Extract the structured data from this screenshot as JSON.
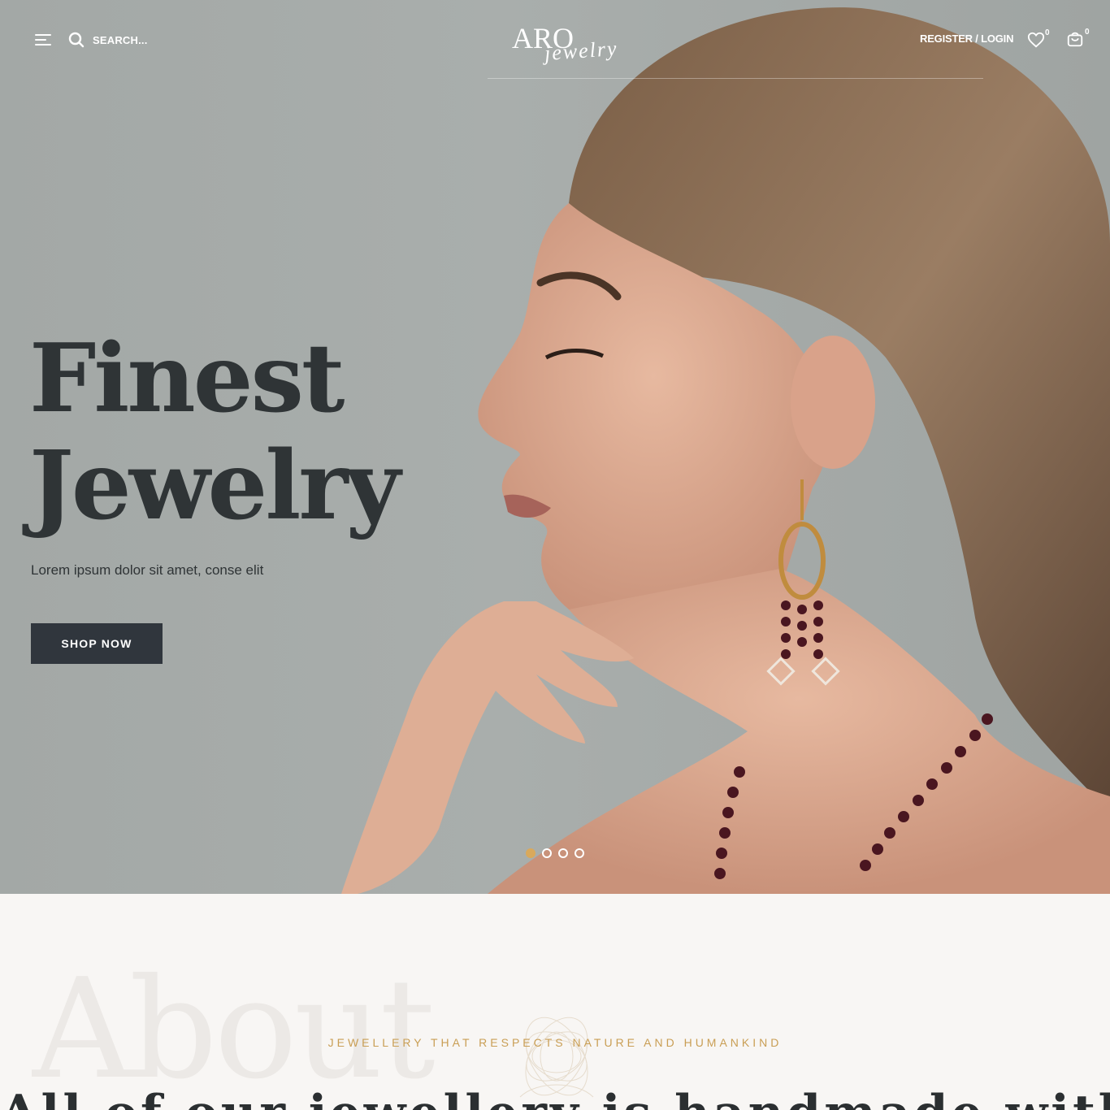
{
  "header": {
    "search_placeholder": "SEARCH...",
    "logo_main": "ARO",
    "logo_sub": "jewelry",
    "login_label": "REGISTER / LOGIN",
    "wishlist_count": "0",
    "cart_count": "0"
  },
  "hero": {
    "title_line1": "Finest",
    "title_line2": "Jewelry",
    "subtitle": "Lorem ipsum dolor sit amet, conse elit",
    "button_label": "SHOP NOW",
    "slides": 4,
    "active_slide": 1
  },
  "about": {
    "background_word": "About",
    "kicker": "JEWELLERY THAT RESPECTS NATURE AND HUMANKIND",
    "heading": "All of our jewellery is handmade with"
  },
  "colors": {
    "accent": "#d9a95c",
    "dark": "#30363d",
    "hero_bg": "#a7acaa",
    "section_bg": "#f8f6f4"
  },
  "icons": [
    "menu-icon",
    "search-icon",
    "heart-icon",
    "shopping-bag-icon",
    "flower-icon"
  ]
}
